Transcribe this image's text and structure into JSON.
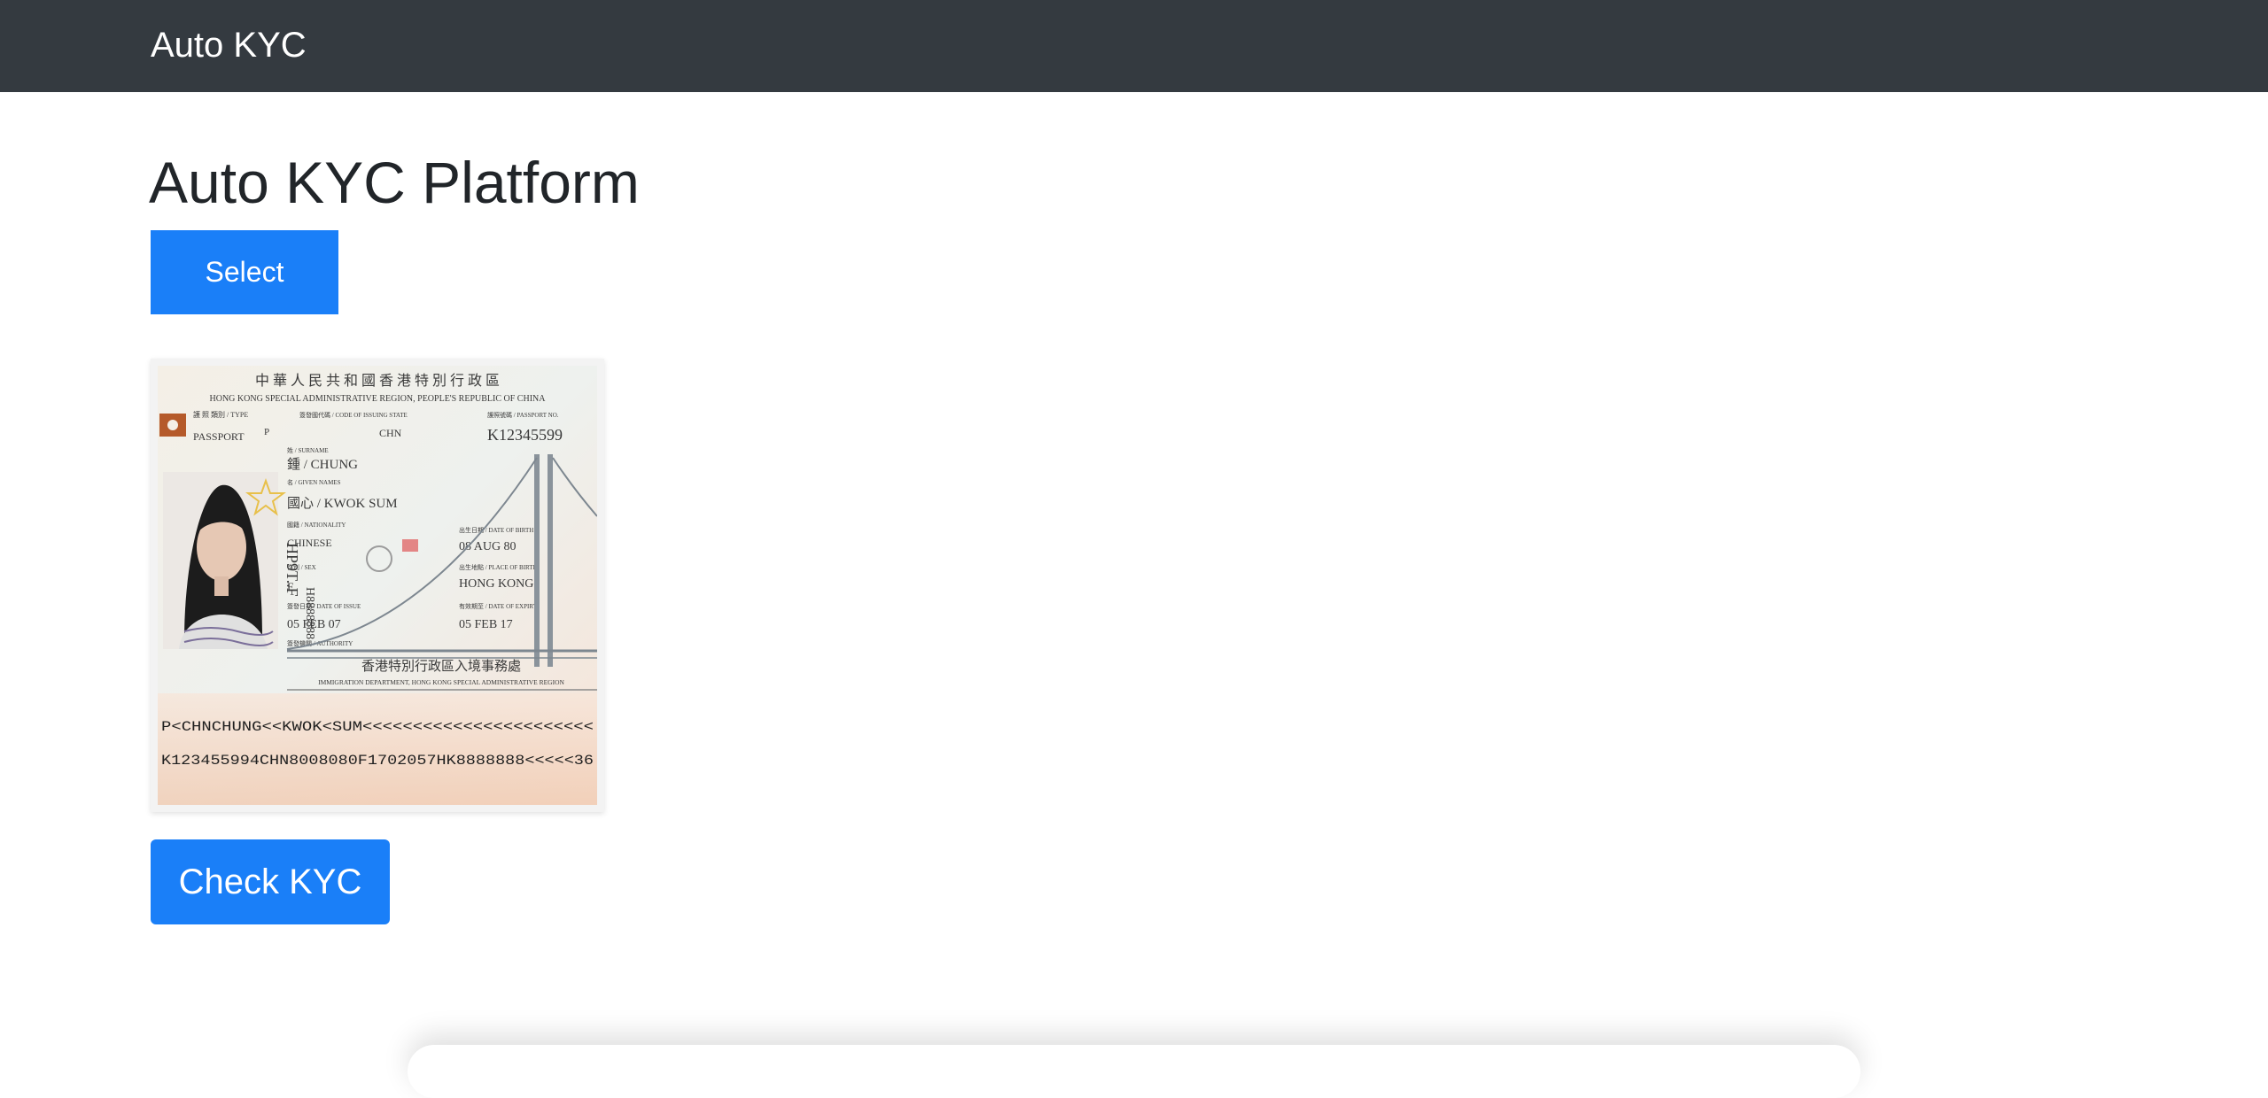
{
  "navbar": {
    "brand": "Auto KYC"
  },
  "main": {
    "title": "Auto KYC Platform",
    "select_label": "Select",
    "check_label": "Check KYC"
  },
  "passport": {
    "header_cn": "中 華 人 民 共 和 國 香 港 特 別 行 政 區",
    "header_en": "HONG KONG SPECIAL ADMINISTRATIVE REGION, PEOPLE'S REPUBLIC OF CHINA",
    "type_label": "護 照 類別 / TYPE",
    "state_label": "簽發國代碼 / CODE OF ISSUING STATE",
    "no_label": "護照號碼 / PASSPORT NO.",
    "doc": "PASSPORT",
    "type": "P",
    "state": "CHN",
    "number": "K12345599",
    "surname_label": "姓 / SURNAME",
    "surname": "鍾 / CHUNG",
    "given_label": "名 / GIVEN NAMES",
    "given": "國心 / KWOK SUM",
    "nationality_label": "國籍 / NATIONALITY",
    "nationality": "CHINESE",
    "dob_label": "出生日期 / DATE OF BIRTH",
    "dob": "08 AUG 80",
    "sex_label": "性別 / SEX",
    "sex": "F",
    "pob_label": "出生地點 / PLACE OF BIRTH",
    "pob": "HONG KONG",
    "issue_label": "簽發日期 / DATE OF ISSUE",
    "issue": "05 FEB 07",
    "expiry_label": "有效期至 / DATE OF EXPIRY",
    "expiry": "05 FEB 17",
    "authority_label": "簽發機關 / AUTHORITY",
    "authority_cn": "香港特別行政區入境事務處",
    "authority_en": "IMMIGRATION DEPARTMENT, HONG KONG SPECIAL ADMINISTRATIVE REGION",
    "side_text": "HP9T..F",
    "side_number": "H8888888",
    "mrz1": "P<CHNCHUNG<<KWOK<SUM<<<<<<<<<<<<<<<<<<<<<<<",
    "mrz2": "K123455994CHN8008080F1702057HK8888888<<<<<36"
  },
  "colors": {
    "navbar": "#343a40",
    "primary": "#1a7ff8",
    "text": "#212529"
  }
}
